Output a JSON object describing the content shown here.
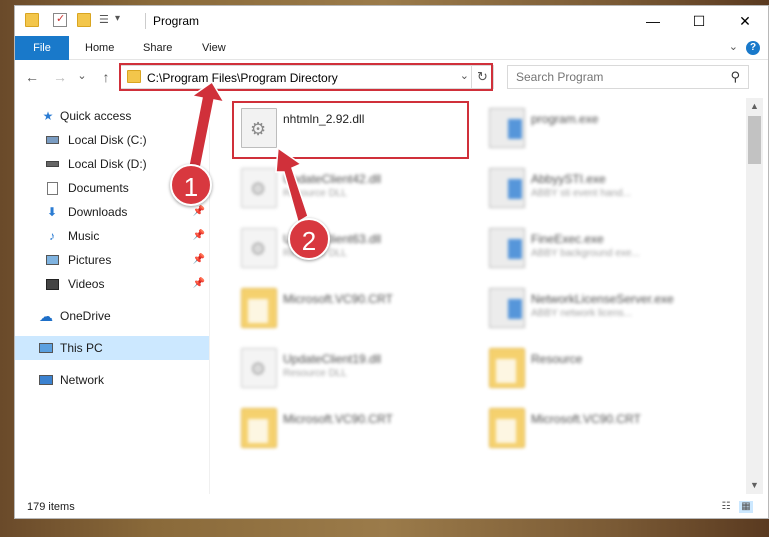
{
  "window": {
    "title": "Program",
    "controls": {
      "minimize": "—",
      "maximize": "☐",
      "close": "✕"
    }
  },
  "ribbon": {
    "tabs": [
      {
        "label": "File"
      },
      {
        "label": "Home"
      },
      {
        "label": "Share"
      },
      {
        "label": "View"
      }
    ],
    "help_label": "?"
  },
  "navigation": {
    "back": "←",
    "forward": "→",
    "recent": "⌄",
    "up": "↑",
    "address": "C:\\Program Files\\Program Directory",
    "search_placeholder": "Search Program"
  },
  "sidebar": {
    "items": [
      {
        "label": "Quick access",
        "icon": "star-icon"
      },
      {
        "label": "Local Disk (C:)",
        "icon": "drive-icon"
      },
      {
        "label": "Local Disk (D:)",
        "icon": "drive-icon"
      },
      {
        "label": "Documents",
        "icon": "document-icon"
      },
      {
        "label": "Downloads",
        "icon": "download-icon",
        "pinned": true
      },
      {
        "label": "Music",
        "icon": "music-icon",
        "pinned": true
      },
      {
        "label": "Pictures",
        "icon": "pictures-icon",
        "pinned": true
      },
      {
        "label": "Videos",
        "icon": "videos-icon",
        "pinned": true
      },
      {
        "label": "OneDrive",
        "icon": "cloud-icon"
      },
      {
        "label": "This PC",
        "icon": "computer-icon",
        "selected": true
      },
      {
        "label": "Network",
        "icon": "network-icon"
      }
    ]
  },
  "files": [
    {
      "name": "nhtmln_2.92.dll",
      "desc": "",
      "type": "dll",
      "highlighted": true
    },
    {
      "name": "program.exe",
      "desc": "",
      "type": "exe"
    },
    {
      "name": "UpdateClient42.dll",
      "desc": "Resource DLL",
      "type": "dll"
    },
    {
      "name": "AbbyySTI.exe",
      "desc": "ABBY sti event hand...",
      "type": "exe"
    },
    {
      "name": "UpdateClient63.dll",
      "desc": "Resource DLL",
      "type": "dll"
    },
    {
      "name": "FineExec.exe",
      "desc": "ABBY background exe...",
      "type": "exe"
    },
    {
      "name": "Microsoft.VC90.CRT",
      "desc": "",
      "type": "folder"
    },
    {
      "name": "NetworkLicenseServer.exe",
      "desc": "ABBY network licens...",
      "type": "exe"
    },
    {
      "name": "UpdateClient19.dll",
      "desc": "Resource DLL",
      "type": "dll"
    },
    {
      "name": "Resource",
      "desc": "",
      "type": "folder"
    },
    {
      "name": "Microsoft.VC90.CRT",
      "desc": "",
      "type": "folder"
    },
    {
      "name": "Microsoft.VC90.CRT",
      "desc": "",
      "type": "folder"
    }
  ],
  "status": {
    "item_count": "179 items"
  },
  "annotations": {
    "step1": "1",
    "step2": "2",
    "color": "#d0303a"
  }
}
